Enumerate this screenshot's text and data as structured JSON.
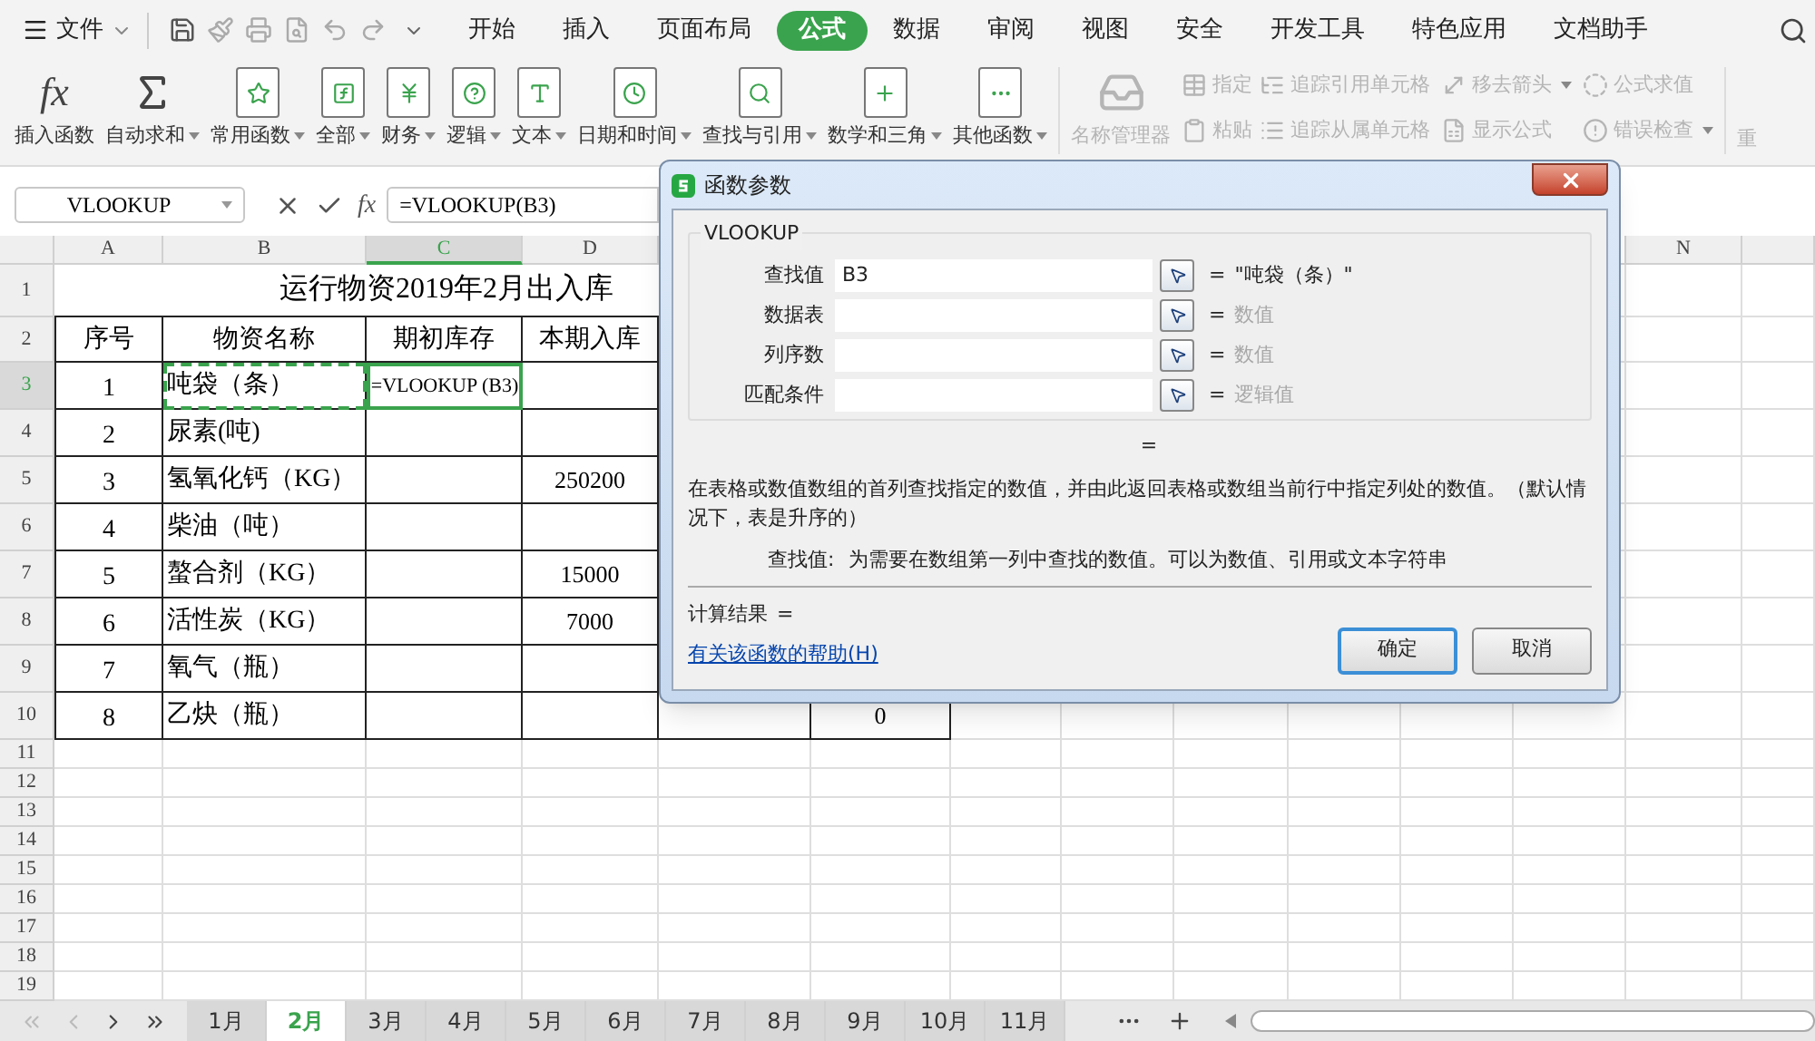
{
  "menu_bar": {
    "file": "文件",
    "tabs": [
      {
        "label": "开始",
        "selected": false
      },
      {
        "label": "插入",
        "selected": false
      },
      {
        "label": "页面布局",
        "selected": false
      },
      {
        "label": "公式",
        "selected": true
      },
      {
        "label": "数据",
        "selected": false
      },
      {
        "label": "审阅",
        "selected": false
      },
      {
        "label": "视图",
        "selected": false
      },
      {
        "label": "安全",
        "selected": false
      },
      {
        "label": "开发工具",
        "selected": false
      },
      {
        "label": "特色应用",
        "selected": false
      },
      {
        "label": "文档助手",
        "selected": false
      }
    ]
  },
  "ribbon": {
    "insert_function": {
      "glyph": "fx",
      "label": "插入函数"
    },
    "functions": [
      {
        "label": "自动求和",
        "dropdown": true
      },
      {
        "label": "常用函数",
        "dropdown": true
      },
      {
        "label": "全部",
        "dropdown": true
      },
      {
        "label": "财务",
        "dropdown": true
      },
      {
        "label": "逻辑",
        "dropdown": true
      },
      {
        "label": "文本",
        "dropdown": true
      },
      {
        "label": "日期和时间",
        "dropdown": true
      },
      {
        "label": "查找与引用",
        "dropdown": true
      },
      {
        "label": "数学和三角",
        "dropdown": true
      },
      {
        "label": "其他函数",
        "dropdown": true
      }
    ],
    "tools": [
      {
        "kind": "large",
        "items": [
          {
            "label": "名称管理器",
            "disabled": true,
            "dropdown": false
          }
        ]
      },
      {
        "kind": "stack",
        "items": [
          {
            "label": "指定",
            "disabled": true,
            "dropdown": false
          },
          {
            "label": "粘贴",
            "disabled": true,
            "dropdown": false
          }
        ]
      },
      {
        "kind": "stack",
        "items": [
          {
            "label": "追踪引用单元格",
            "disabled": true,
            "dropdown": false
          },
          {
            "label": "追踪从属单元格",
            "disabled": true,
            "dropdown": false
          }
        ]
      },
      {
        "kind": "stack",
        "items": [
          {
            "label": "移去箭头",
            "disabled": true,
            "dropdown": true
          },
          {
            "label": "显示公式",
            "disabled": true,
            "dropdown": false
          }
        ]
      },
      {
        "kind": "stack",
        "items": [
          {
            "label": "公式求值",
            "disabled": true,
            "dropdown": false
          },
          {
            "label": "错误检查",
            "disabled": true,
            "dropdown": true
          }
        ]
      }
    ],
    "recalc": {
      "label": "重",
      "disabled": true
    }
  },
  "formula_bar": {
    "name_box": "VLOOKUP",
    "fx": "fx",
    "formula": "=VLOOKUP(B3)"
  },
  "columns": [
    {
      "label": "A",
      "selected": false
    },
    {
      "label": "B",
      "selected": false
    },
    {
      "label": "C",
      "selected": true
    },
    {
      "label": "D",
      "selected": false
    },
    {
      "label": "N",
      "selected": false
    }
  ],
  "row_numbers": [
    {
      "label": "1",
      "selected": false
    },
    {
      "label": "2",
      "selected": false
    },
    {
      "label": "3",
      "selected": true
    },
    {
      "label": "4",
      "selected": false
    },
    {
      "label": "5",
      "selected": false
    },
    {
      "label": "6",
      "selected": false
    },
    {
      "label": "7",
      "selected": false
    },
    {
      "label": "8",
      "selected": false
    },
    {
      "label": "9",
      "selected": false
    },
    {
      "label": "10",
      "selected": false
    },
    {
      "label": "11",
      "selected": false
    },
    {
      "label": "12",
      "selected": false
    },
    {
      "label": "13",
      "selected": false
    },
    {
      "label": "14",
      "selected": false
    },
    {
      "label": "15",
      "selected": false
    },
    {
      "label": "16",
      "selected": false
    },
    {
      "label": "17",
      "selected": false
    },
    {
      "label": "18",
      "selected": false
    },
    {
      "label": "19",
      "selected": false
    }
  ],
  "sheet": {
    "title": "运行物资2019年2月出入库",
    "header": [
      "序号",
      "物资名称",
      "期初库存",
      "本期入库"
    ],
    "rows": [
      {
        "no": "1",
        "name": "吨袋（条）",
        "opening": "=VLOOKUP (B3)",
        "referenced": true,
        "active": true
      },
      {
        "no": "2",
        "name": "尿素(吨)",
        "referenced": false,
        "active": false
      },
      {
        "no": "3",
        "name": "氢氧化钙（KG）",
        "received": "250200",
        "referenced": false,
        "active": false
      },
      {
        "no": "4",
        "name": "柴油（吨）",
        "referenced": false,
        "active": false
      },
      {
        "no": "5",
        "name": "螯合剂（KG）",
        "received": "15000",
        "referenced": false,
        "active": false
      },
      {
        "no": "6",
        "name": "活性炭（KG）",
        "received": "7000",
        "referenced": false,
        "active": false
      },
      {
        "no": "7",
        "name": "氧气（瓶）",
        "referenced": false,
        "active": false
      },
      {
        "no": "8",
        "name": "乙炔（瓶）",
        "column_6": "0",
        "referenced": false,
        "active": false
      }
    ]
  },
  "dialog": {
    "title": "函数参数",
    "function_name": "VLOOKUP",
    "arguments": [
      {
        "label": "查找值",
        "value": "B3",
        "equals": "=",
        "result": "\"吨袋（条）\"",
        "kind": "value"
      },
      {
        "label": "数据表",
        "equals": "=",
        "result": "数值",
        "kind": "hint"
      },
      {
        "label": "列序数",
        "equals": "=",
        "result": "数值",
        "kind": "hint"
      },
      {
        "label": "匹配条件",
        "equals": "=",
        "result": "逻辑值",
        "kind": "hint"
      }
    ],
    "formula_result": "=",
    "description": "在表格或数值数组的首列查找指定的数值，并由此返回表格或数组当前行中指定列处的数值。（默认情况下，表是升序的）",
    "argument_help": {
      "label": "查找值:",
      "text": "为需要在数组第一列中查找的数值。可以为数值、引用或文本字符串"
    },
    "calc_result": {
      "label": "计算结果",
      "value": "="
    },
    "help_link": "有关该函数的帮助(H)",
    "buttons": [
      {
        "label": "确定",
        "default": true
      },
      {
        "label": "取消",
        "default": false
      }
    ]
  },
  "sheet_tabs": [
    {
      "label": "1月",
      "selected": false
    },
    {
      "label": "2月",
      "selected": true
    },
    {
      "label": "3月",
      "selected": false
    },
    {
      "label": "4月",
      "selected": false
    },
    {
      "label": "5月",
      "selected": false
    },
    {
      "label": "6月",
      "selected": false
    },
    {
      "label": "7月",
      "selected": false
    },
    {
      "label": "8月",
      "selected": false
    },
    {
      "label": "9月",
      "selected": false
    },
    {
      "label": "10月",
      "selected": false
    },
    {
      "label": "11月",
      "selected": false
    }
  ]
}
